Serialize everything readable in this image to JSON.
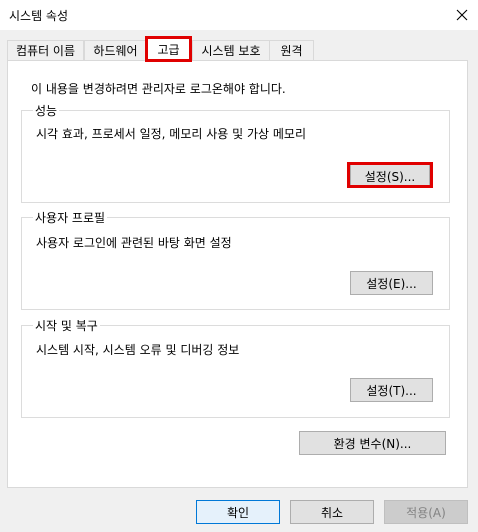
{
  "window": {
    "title": "시스템 속성"
  },
  "tabs": [
    "컴퓨터 이름",
    "하드웨어",
    "고급",
    "시스템 보호",
    "원격"
  ],
  "advanced": {
    "notice": "이 내용을 변경하려면 관리자로 로그온해야 합니다.",
    "performance": {
      "legend": "성능",
      "description": "시각 효과, 프로세서 일정, 메모리 사용 및 가상 메모리",
      "button": "설정(S)..."
    },
    "user_profiles": {
      "legend": "사용자 프로필",
      "description": "사용자 로그인에 관련된 바탕 화면 설정",
      "button": "설정(E)..."
    },
    "startup_recovery": {
      "legend": "시작 및 복구",
      "description": "시스템 시작, 시스템 오류 및 디버깅 정보",
      "button": "설정(T)..."
    },
    "env_button": "환경 변수(N)..."
  },
  "footer": {
    "ok": "확인",
    "cancel": "취소",
    "apply": "적용(A)"
  },
  "annotation_color": "#e00000"
}
